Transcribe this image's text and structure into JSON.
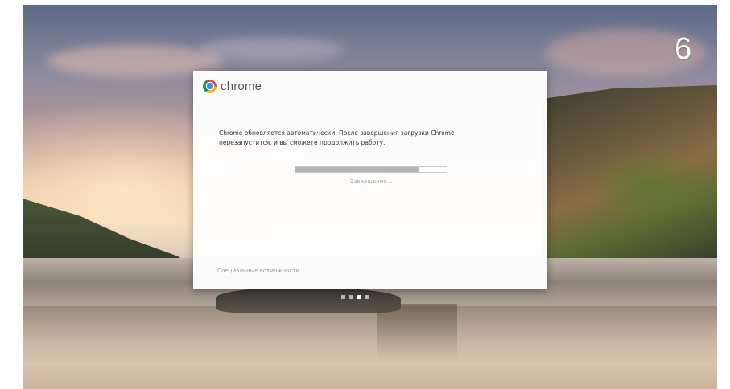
{
  "overlay": {
    "step_number": "6"
  },
  "dialog": {
    "logo_text": "chrome",
    "message": "Chrome обновляется автоматически. После завершения загрузки Chrome перезапустится, и вы сможете продолжить работу.",
    "progress_fraction": 0.82,
    "status": "Завершение...",
    "accessibility_link": "Специальные возможности"
  },
  "pager": {
    "count": 4,
    "active_index": 2
  },
  "colors": {
    "progress_fill": "#b3b3b3",
    "progress_track": "#ffffff",
    "dialog_bg": "#ffffff"
  },
  "icons": {
    "logo": "chrome-logo-icon"
  }
}
